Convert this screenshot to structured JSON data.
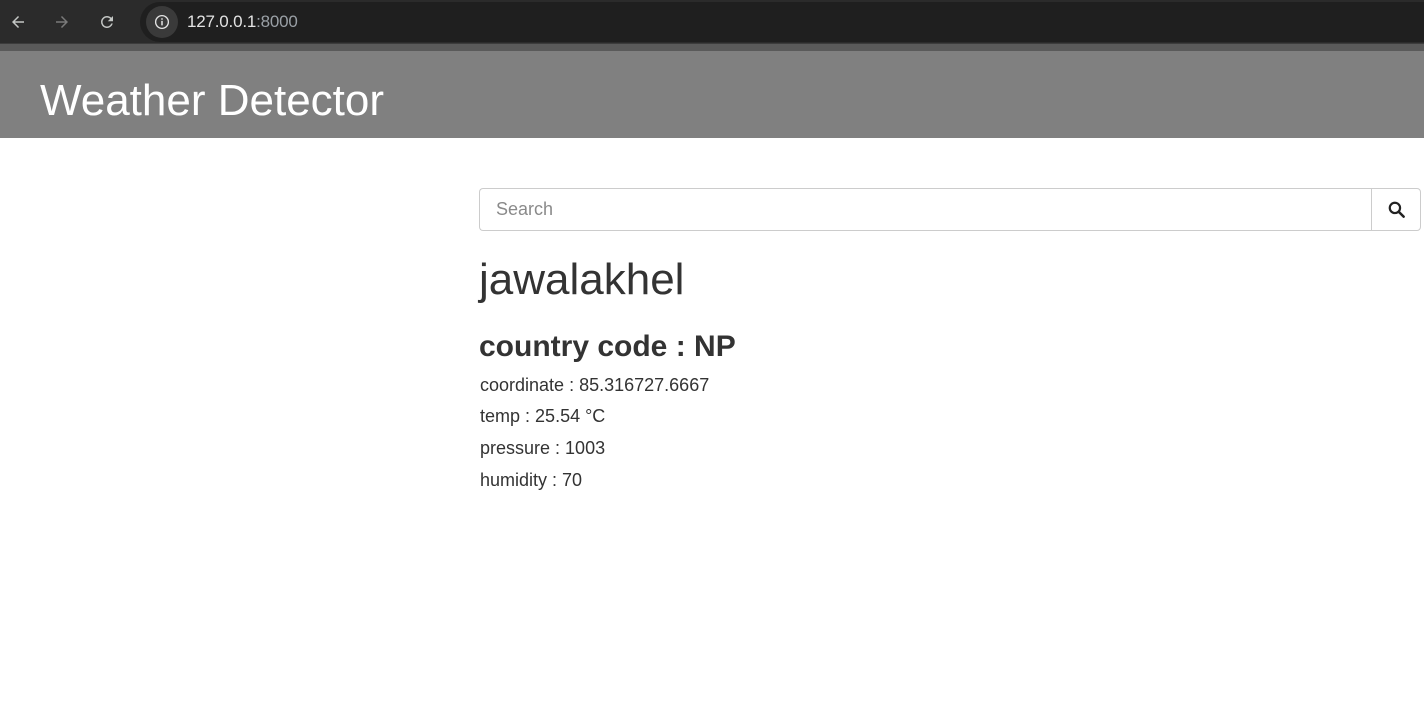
{
  "browser": {
    "url_host": "127.0.0.1",
    "url_port": ":8000"
  },
  "header": {
    "title": "Weather Detector"
  },
  "search": {
    "placeholder": "Search",
    "value": ""
  },
  "result": {
    "city": "jawalakhel",
    "country_label": "country code",
    "country_code": "NP",
    "coordinate_label": "coordinate",
    "coordinate_value": "85.316727.6667",
    "temp_label": "temp",
    "temp_value": "25.54 °C",
    "pressure_label": "pressure",
    "pressure_value": "1003",
    "humidity_label": "humidity",
    "humidity_value": "70"
  },
  "colors": {
    "header_bg": "#808080",
    "text": "#333333",
    "chrome_bg": "#2b2b2b"
  }
}
